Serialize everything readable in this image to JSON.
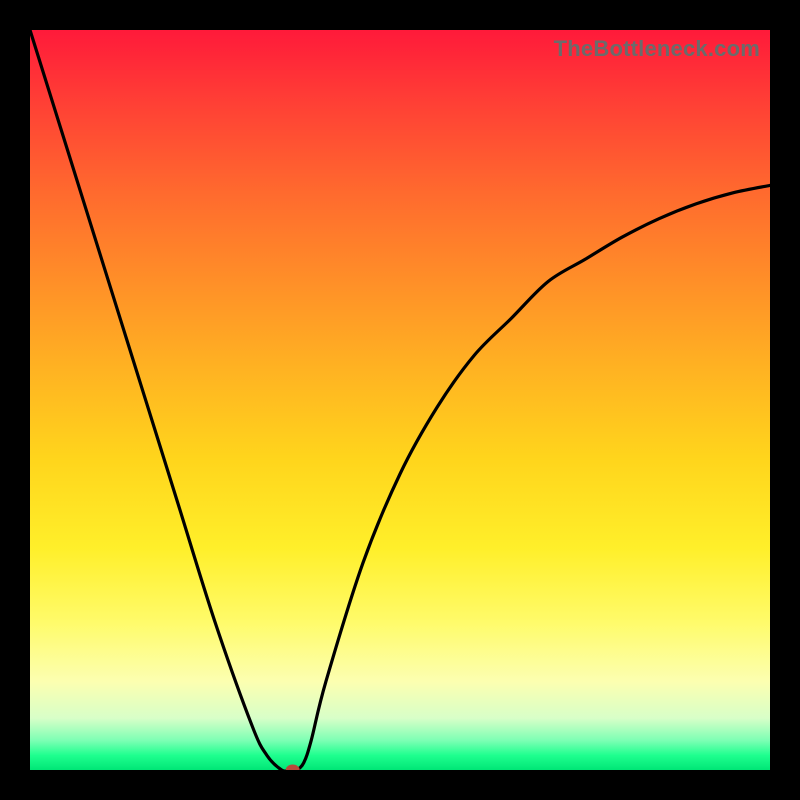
{
  "watermark": "TheBottleneck.com",
  "chart_data": {
    "type": "line",
    "title": "",
    "xlabel": "",
    "ylabel": "",
    "xlim": [
      0,
      100
    ],
    "ylim": [
      0,
      100
    ],
    "grid": false,
    "legend": false,
    "x": [
      0,
      5,
      10,
      15,
      20,
      25,
      30,
      32,
      34,
      35,
      36,
      37,
      38,
      40,
      45,
      50,
      55,
      60,
      65,
      70,
      75,
      80,
      85,
      90,
      95,
      100
    ],
    "y": [
      100,
      84,
      68,
      52,
      36,
      20,
      6,
      2,
      0,
      0,
      0,
      1,
      4,
      12,
      28,
      40,
      49,
      56,
      61,
      66,
      69,
      72,
      74.5,
      76.5,
      78,
      79
    ],
    "annotations": [
      {
        "type": "point",
        "x": 35.5,
        "y": 0,
        "color": "#b84a3a"
      }
    ],
    "background_gradient": {
      "direction": "vertical",
      "stops": [
        {
          "pos": 0.0,
          "color": "#ff1a3a"
        },
        {
          "pos": 0.5,
          "color": "#ffd51c"
        },
        {
          "pos": 0.88,
          "color": "#fcffb0"
        },
        {
          "pos": 1.0,
          "color": "#00e676"
        }
      ]
    }
  }
}
